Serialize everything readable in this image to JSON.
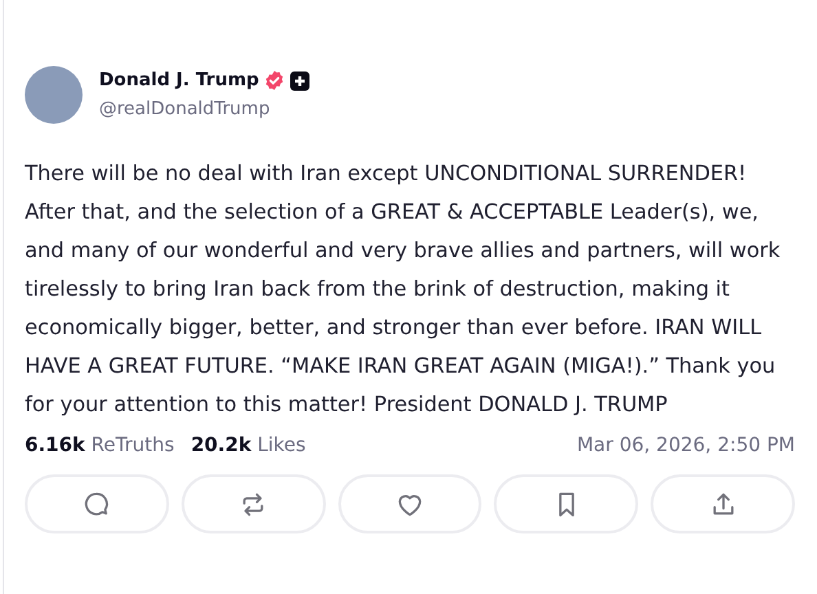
{
  "post": {
    "author": {
      "name": "Donald J. Trump",
      "handle": "@realDonaldTrump",
      "verified": true,
      "plus_member": true
    },
    "body": "There will be no deal with Iran except UNCONDITIONAL SURRENDER! After that, and the selection of a GREAT & ACCEPTABLE Leader(s), we, and many of our wonderful and very brave allies and partners, will work tirelessly to bring Iran back from the brink of destruction, making it economically bigger, better, and stronger than ever before. IRAN WILL HAVE A GREAT FUTURE. “MAKE IRAN GREAT AGAIN (MIGA!).” Thank you for your attention to this matter! President DONALD J. TRUMP",
    "stats": [
      {
        "count": "6.16k",
        "label": "ReTruths"
      },
      {
        "count": "20.2k",
        "label": "Likes"
      }
    ],
    "timestamp": "Mar 06, 2026, 2:50 PM",
    "actions": [
      {
        "kind": "reply"
      },
      {
        "kind": "retruth"
      },
      {
        "kind": "like"
      },
      {
        "kind": "bookmark"
      },
      {
        "kind": "share"
      }
    ]
  }
}
